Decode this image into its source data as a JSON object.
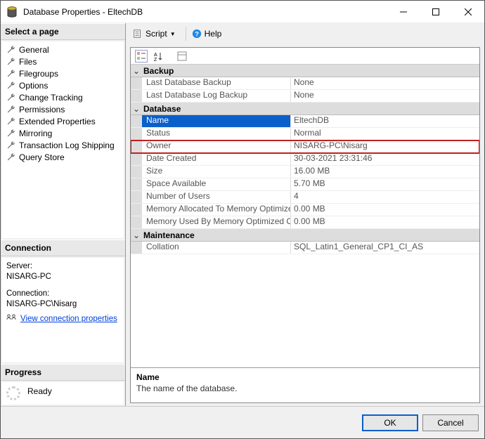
{
  "window": {
    "title": "Database Properties - EltechDB"
  },
  "win_controls": {
    "min": "minimize",
    "max": "maximize",
    "close": "close"
  },
  "left": {
    "header_pages": "Select a page",
    "pages": [
      "General",
      "Files",
      "Filegroups",
      "Options",
      "Change Tracking",
      "Permissions",
      "Extended Properties",
      "Mirroring",
      "Transaction Log Shipping",
      "Query Store"
    ],
    "header_conn": "Connection",
    "conn": {
      "server_lbl": "Server:",
      "server_val": "NISARG-PC",
      "conn_lbl": "Connection:",
      "conn_val": "NISARG-PC\\Nisarg",
      "link": "View connection properties"
    },
    "header_prog": "Progress",
    "progress": "Ready"
  },
  "toolbar": {
    "script_label": "Script",
    "help_label": "Help"
  },
  "props": {
    "categories": [
      {
        "name": "Backup",
        "rows": [
          {
            "name": "Last Database Backup",
            "value": "None"
          },
          {
            "name": "Last Database Log Backup",
            "value": "None"
          }
        ]
      },
      {
        "name": "Database",
        "rows": [
          {
            "name": "Name",
            "value": "EltechDB",
            "selected": true
          },
          {
            "name": "Status",
            "value": "Normal"
          },
          {
            "name": "Owner",
            "value": "NISARG-PC\\Nisarg",
            "highlighted": true
          },
          {
            "name": "Date Created",
            "value": "30-03-2021 23:31:46"
          },
          {
            "name": "Size",
            "value": "16.00 MB"
          },
          {
            "name": "Space Available",
            "value": "5.70 MB"
          },
          {
            "name": "Number of Users",
            "value": "4"
          },
          {
            "name": "Memory Allocated To Memory Optimized Obj",
            "value": "0.00 MB"
          },
          {
            "name": "Memory Used By Memory Optimized Objects",
            "value": "0.00 MB"
          }
        ]
      },
      {
        "name": "Maintenance",
        "rows": [
          {
            "name": "Collation",
            "value": "SQL_Latin1_General_CP1_CI_AS"
          }
        ]
      }
    ],
    "desc": {
      "name": "Name",
      "text": "The name of the database."
    }
  },
  "footer": {
    "ok": "OK",
    "cancel": "Cancel"
  }
}
